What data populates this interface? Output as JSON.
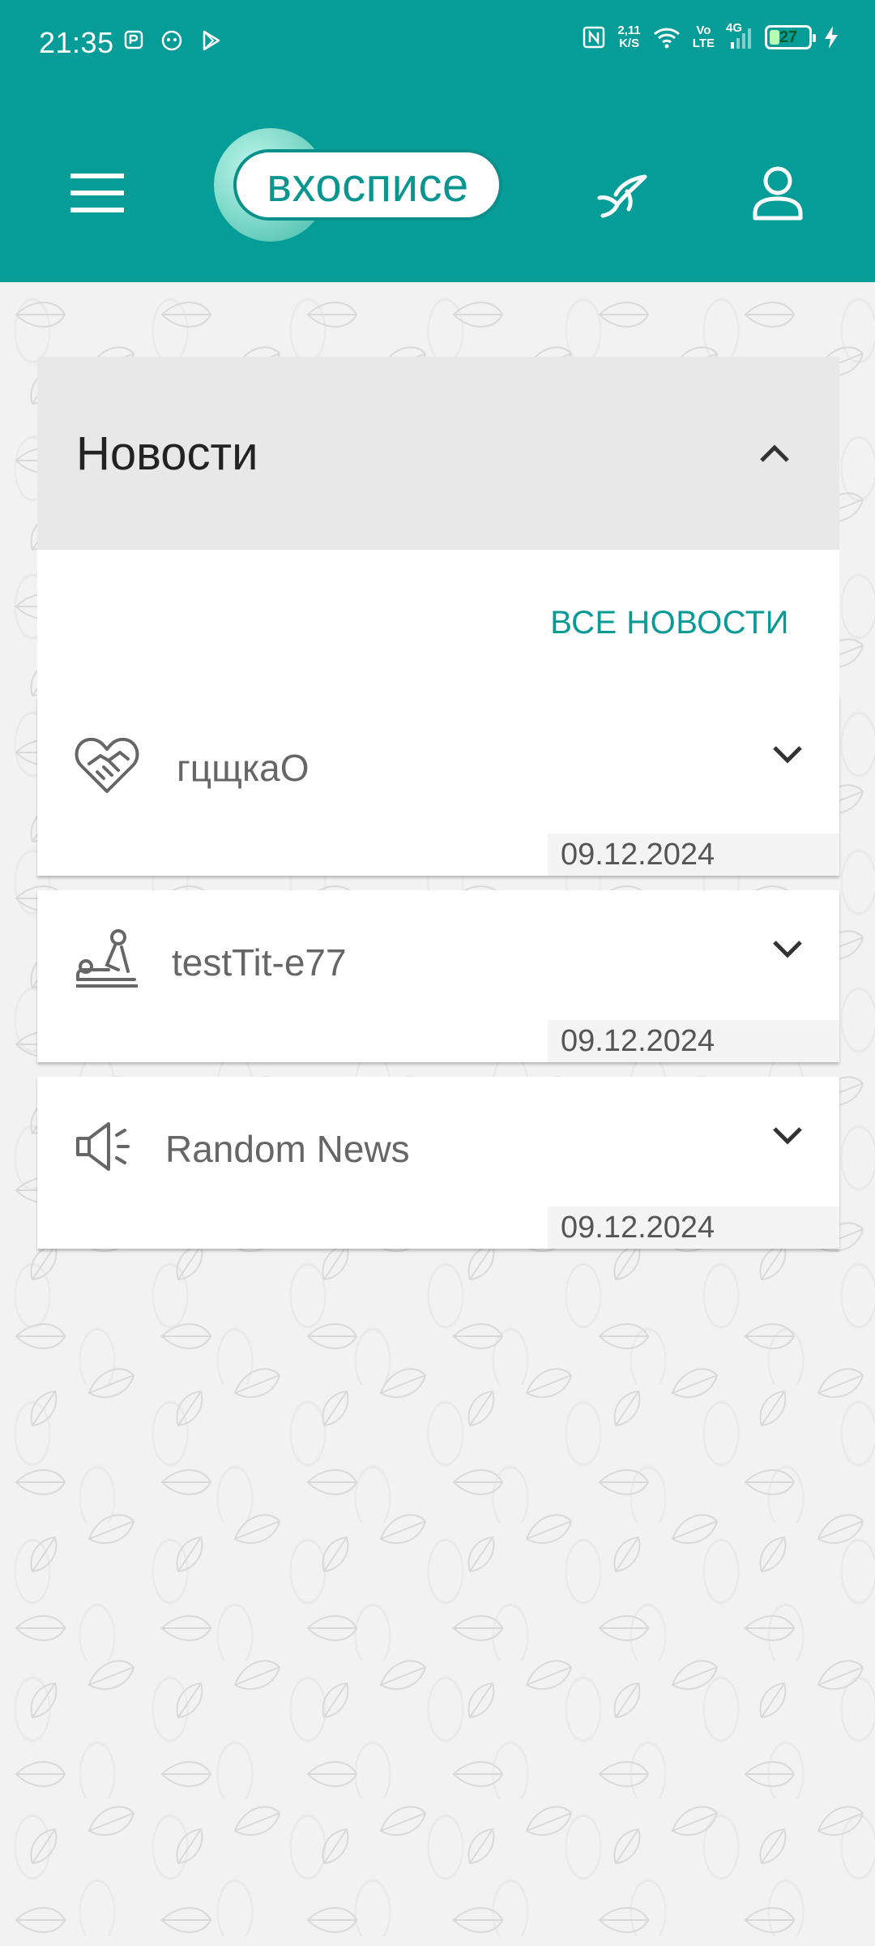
{
  "status_bar": {
    "time": "21:35",
    "net_speed_value": "2,11",
    "net_speed_unit": "K/S",
    "volte_top": "Vo",
    "volte_bottom": "LTE",
    "network": "4G",
    "battery": "27",
    "battery_level": 0.27
  },
  "app_bar": {
    "logo_text": "вхосписе",
    "colors": {
      "primary": "#069c98",
      "accent_text": "#0a9a96"
    }
  },
  "news": {
    "title": "Новости",
    "all_news_label": "ВСЕ НОВОСТИ",
    "items": [
      {
        "icon": "handshake-heart-icon",
        "title": "гцщкаО",
        "date": "09.12.2024"
      },
      {
        "icon": "massage-icon",
        "title": "testTit-e77",
        "date": "09.12.2024"
      },
      {
        "icon": "megaphone-icon",
        "title": "Random News",
        "date": "09.12.2024"
      }
    ]
  }
}
